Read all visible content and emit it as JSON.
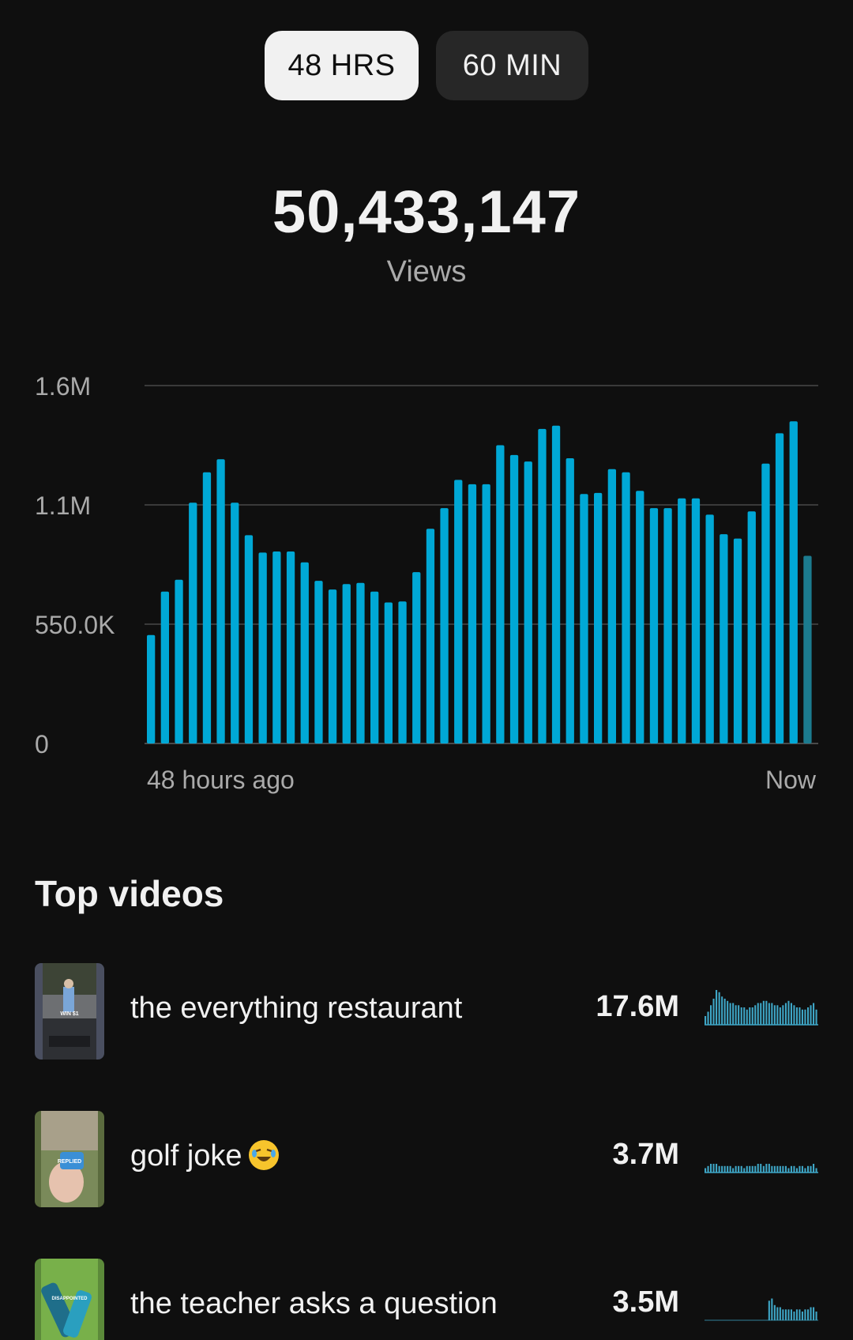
{
  "toggles": [
    {
      "label": "48 HRS",
      "active": true
    },
    {
      "label": "60 MIN",
      "active": false
    }
  ],
  "summary": {
    "total": "50,433,147",
    "label": "Views"
  },
  "chart_data": {
    "type": "bar",
    "title": "",
    "xlabel": "",
    "ylabel": "",
    "x_start_label": "48 hours ago",
    "x_end_label": "Now",
    "y_ticks": [
      "0",
      "550.0K",
      "1.1M",
      "1.6M"
    ],
    "y_tick_values": [
      0,
      550000,
      1100000,
      1650000
    ],
    "ylim": [
      0,
      1650000
    ],
    "grid": true,
    "bar_color": "#00a8d6",
    "partial_bar_color": "#1c7b8f",
    "values": [
      500000,
      700000,
      755000,
      1110000,
      1250000,
      1310000,
      1110000,
      960000,
      880000,
      885000,
      885000,
      835000,
      750000,
      710000,
      735000,
      740000,
      700000,
      650000,
      655000,
      790000,
      990000,
      1085000,
      1215000,
      1195000,
      1195000,
      1375000,
      1330000,
      1300000,
      1450000,
      1465000,
      1315000,
      1150000,
      1155000,
      1265000,
      1250000,
      1165000,
      1085000,
      1085000,
      1130000,
      1130000,
      1055000,
      965000,
      945000,
      1070000,
      1290000,
      1430000,
      1485000,
      865000
    ],
    "partial_last_bar": true
  },
  "top_videos": {
    "title": "Top videos",
    "items": [
      {
        "title": "the everything restaurant",
        "views": "17.6M",
        "thumb_text": "WIN $1",
        "spark": [
          4,
          6,
          9,
          12,
          16,
          15,
          13,
          12,
          11,
          10,
          10,
          9,
          9,
          8,
          8,
          7,
          8,
          8,
          9,
          10,
          10,
          11,
          11,
          10,
          10,
          9,
          9,
          8,
          9,
          10,
          11,
          10,
          9,
          8,
          8,
          7,
          7,
          8,
          9,
          10,
          7
        ]
      },
      {
        "title": "golf joke",
        "views": "3.7M",
        "thumb_text": "REPLIED",
        "spark": [
          2,
          3,
          4,
          4,
          4,
          3,
          3,
          3,
          3,
          3,
          2,
          3,
          3,
          3,
          2,
          3,
          3,
          3,
          3,
          4,
          4,
          3,
          4,
          4,
          3,
          3,
          3,
          3,
          3,
          3,
          2,
          3,
          3,
          2,
          3,
          3,
          2,
          3,
          3,
          4,
          2
        ]
      },
      {
        "title": "the teacher asks a question",
        "views": "3.5M",
        "thumb_text": "DISAPPOINTED",
        "spark": [
          0,
          0,
          0,
          0,
          0,
          0,
          0,
          0,
          0,
          0,
          0,
          0,
          0,
          0,
          0,
          0,
          0,
          0,
          0,
          0,
          0,
          0,
          0,
          9,
          10,
          7,
          6,
          6,
          5,
          5,
          5,
          5,
          4,
          5,
          5,
          4,
          5,
          5,
          6,
          6,
          4
        ]
      }
    ]
  },
  "colors": {
    "background": "#0f0f0f",
    "accent": "#00a8d6",
    "muted_text": "#aaaaaa"
  }
}
